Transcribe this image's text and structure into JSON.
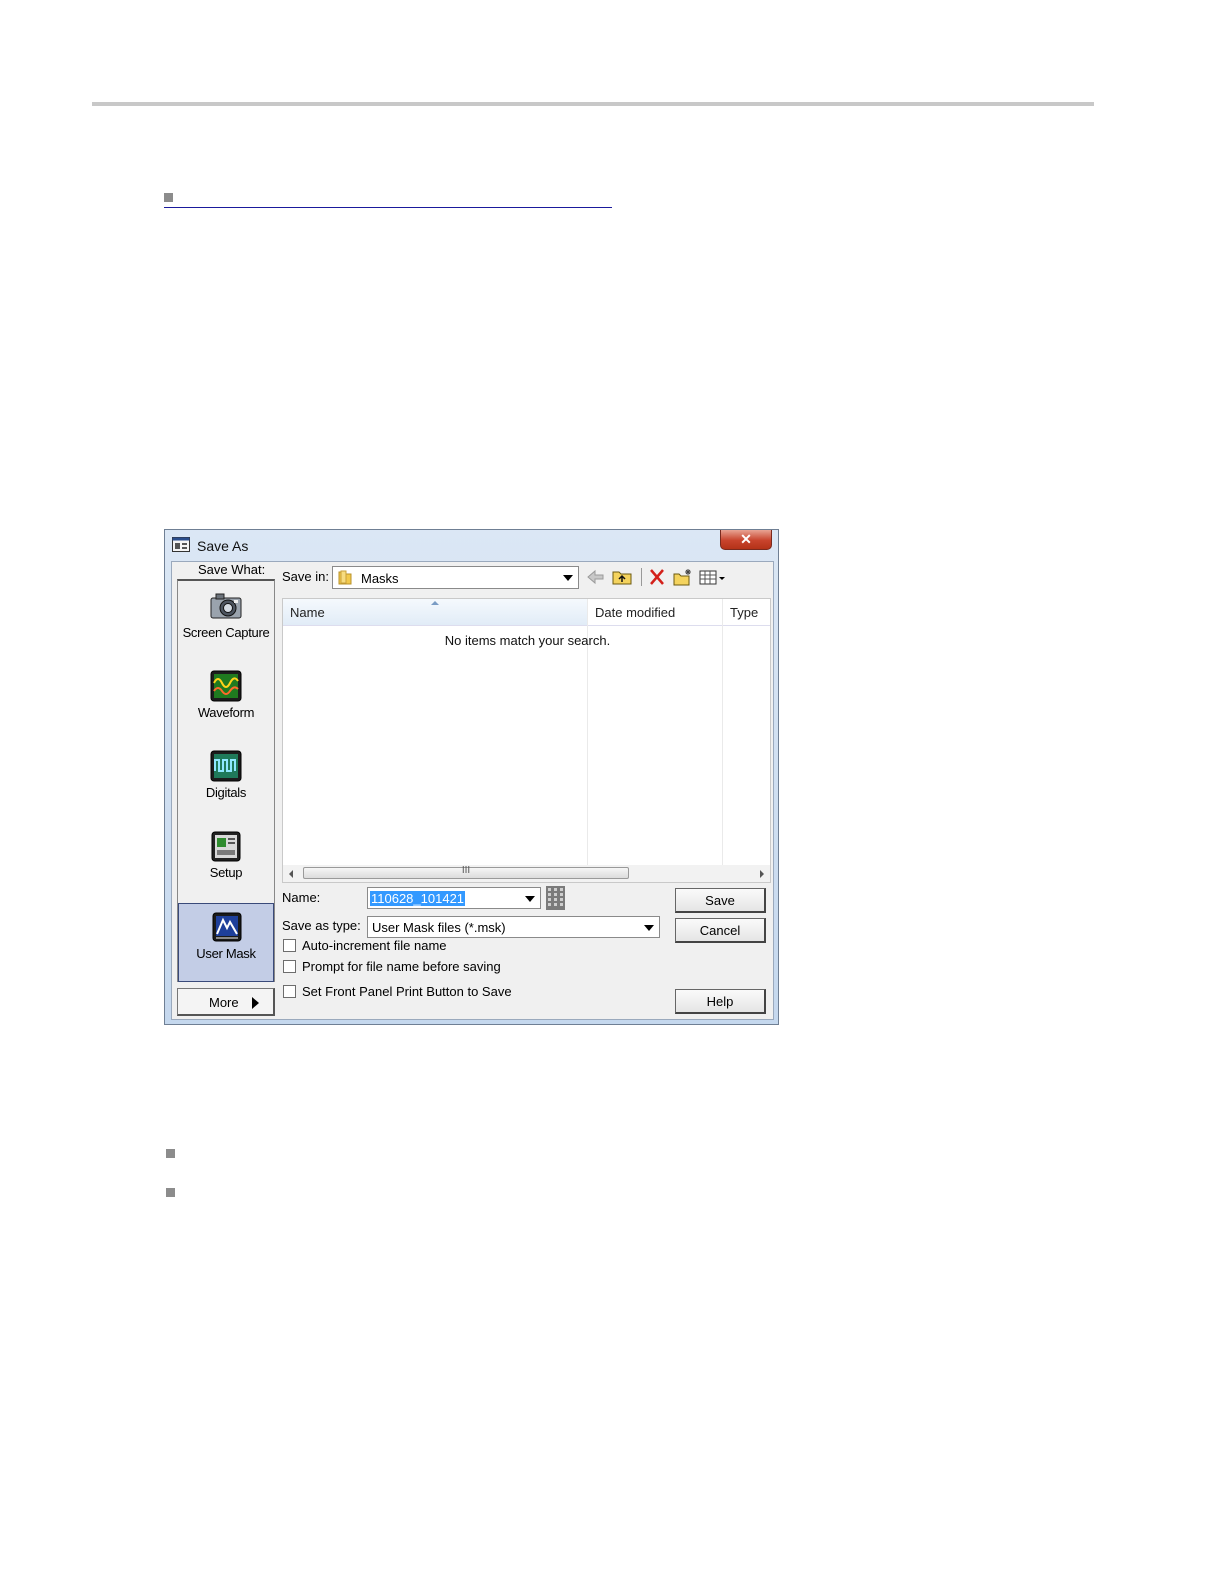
{
  "dialog": {
    "title": "Save As",
    "close_label": "✕",
    "save_what_label": "Save What:",
    "categories": [
      {
        "label": "Screen Capture",
        "icon": "camera-icon",
        "selected": false
      },
      {
        "label": "Waveform",
        "icon": "waveform-icon",
        "selected": false
      },
      {
        "label": "Digitals",
        "icon": "digitals-icon",
        "selected": false
      },
      {
        "label": "Setup",
        "icon": "setup-icon",
        "selected": false
      },
      {
        "label": "User Mask",
        "icon": "user-mask-icon",
        "selected": true
      }
    ],
    "more_label": "More",
    "save_in_label": "Save in:",
    "save_in_value": "Masks",
    "toolbar_icons": [
      "back-arrow-icon",
      "up-folder-icon",
      "delete-icon",
      "new-folder-icon",
      "view-menu-icon"
    ],
    "columns": [
      "Name",
      "Date modified",
      "Type"
    ],
    "empty_message": "No items match your search.",
    "scroll_thumb_glyph": "III",
    "name_label": "Name:",
    "name_value": "110628_101421",
    "save_as_type_label": "Save as type:",
    "save_as_type_value": "User Mask files (*.msk)",
    "options": [
      {
        "label": "Auto-increment file name",
        "checked": false
      },
      {
        "label": "Prompt for file name before saving",
        "checked": false
      },
      {
        "label": "Set Front Panel Print Button to Save",
        "checked": false
      }
    ],
    "buttons": {
      "save": "Save",
      "cancel": "Cancel",
      "help": "Help"
    }
  },
  "colors": {
    "selection": "#3399ff",
    "selected_category": "#c3cde6",
    "close_button": "#c8432c"
  }
}
